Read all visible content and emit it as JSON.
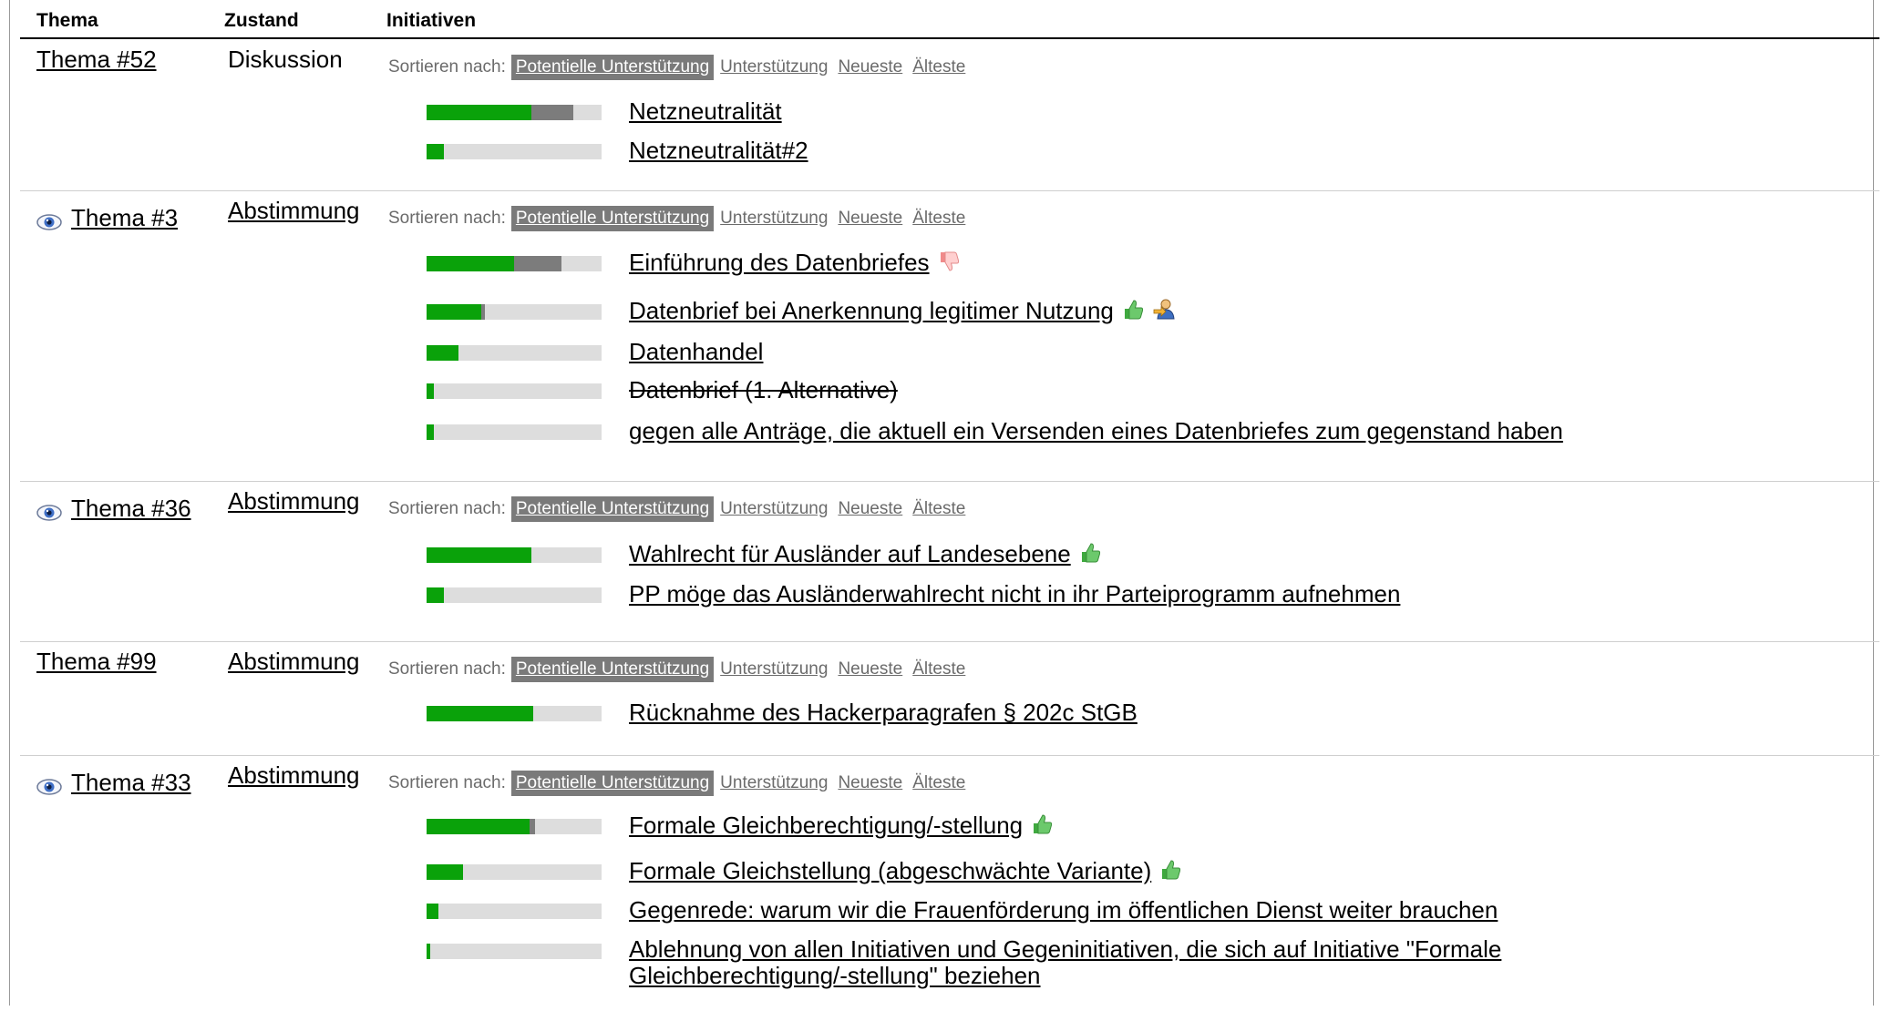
{
  "header": {
    "col_topic": "Thema",
    "col_state": "Zustand",
    "col_initiatives": "Initiativen"
  },
  "sort": {
    "label": "Sortieren nach:",
    "options": [
      "Potentielle Unterstützung",
      "Unterstützung",
      "Neueste",
      "Älteste"
    ]
  },
  "colors": {
    "supporter_bar": "#0aa20a",
    "potential_bar": "#7c7c7c",
    "bar_background": "#dddddd",
    "active_sort_bg": "#7a7a7a"
  },
  "topics": [
    {
      "name": "Thema #52",
      "state": "Diskussion",
      "watched": false,
      "initiatives": [
        {
          "title": "Netzneutralität",
          "support": 0.6,
          "potential": 0.24,
          "icons": []
        },
        {
          "title": "Netzneutralität#2",
          "support": 0.1,
          "potential": 0,
          "icons": []
        }
      ]
    },
    {
      "name": "Thema #3",
      "state": "Abstimmung",
      "watched": true,
      "initiatives": [
        {
          "title": "Einführung des Datenbriefes",
          "support": 0.5,
          "potential": 0.27,
          "icons": [
            "thumbs-down-icon"
          ]
        },
        {
          "title": "Datenbrief bei Anerkennung legitimer Nutzung",
          "support": 0.31,
          "potential": 0.02,
          "icons": [
            "thumbs-up-icon",
            "delegation-icon"
          ]
        },
        {
          "title": "Datenhandel",
          "support": 0.18,
          "potential": 0,
          "icons": []
        },
        {
          "title": "Datenbrief (1. Alternative)",
          "support": 0.04,
          "potential": 0,
          "icons": [],
          "revoked": true
        },
        {
          "title": "gegen alle Anträge, die aktuell ein Versenden eines Datenbriefes zum gegenstand haben",
          "support": 0.04,
          "potential": 0,
          "icons": []
        }
      ]
    },
    {
      "name": "Thema #36",
      "state": "Abstimmung",
      "watched": true,
      "initiatives": [
        {
          "title": "Wahlrecht für Ausländer auf Landesebene",
          "support": 0.6,
          "potential": 0,
          "icons": [
            "thumbs-up-icon"
          ]
        },
        {
          "title": "PP möge das Ausländerwahlrecht nicht in ihr Parteiprogramm aufnehmen",
          "support": 0.1,
          "potential": 0,
          "icons": []
        }
      ]
    },
    {
      "name": "Thema #99",
      "state": "Abstimmung",
      "watched": false,
      "initiatives": [
        {
          "title": "Rücknahme des Hackerparagrafen § 202c StGB",
          "support": 0.61,
          "potential": 0,
          "icons": []
        }
      ]
    },
    {
      "name": "Thema #33",
      "state": "Abstimmung",
      "watched": true,
      "initiatives": [
        {
          "title": "Formale Gleichberechtigung/-stellung",
          "support": 0.59,
          "potential": 0.03,
          "icons": [
            "thumbs-up-icon"
          ]
        },
        {
          "title": "Formale Gleichstellung (abgeschwächte Variante)",
          "support": 0.21,
          "potential": 0,
          "icons": [
            "thumbs-up-icon"
          ]
        },
        {
          "title": "Gegenrede: warum wir die Frauenförderung im öffentlichen Dienst weiter brauchen",
          "support": 0.07,
          "potential": 0,
          "icons": []
        },
        {
          "title": "Ablehnung von allen Initiativen und Gegeninitiativen, die sich auf Initiative \"Formale Gleichberechtigung/-stellung\" beziehen",
          "support": 0.02,
          "potential": 0,
          "icons": []
        }
      ]
    }
  ]
}
